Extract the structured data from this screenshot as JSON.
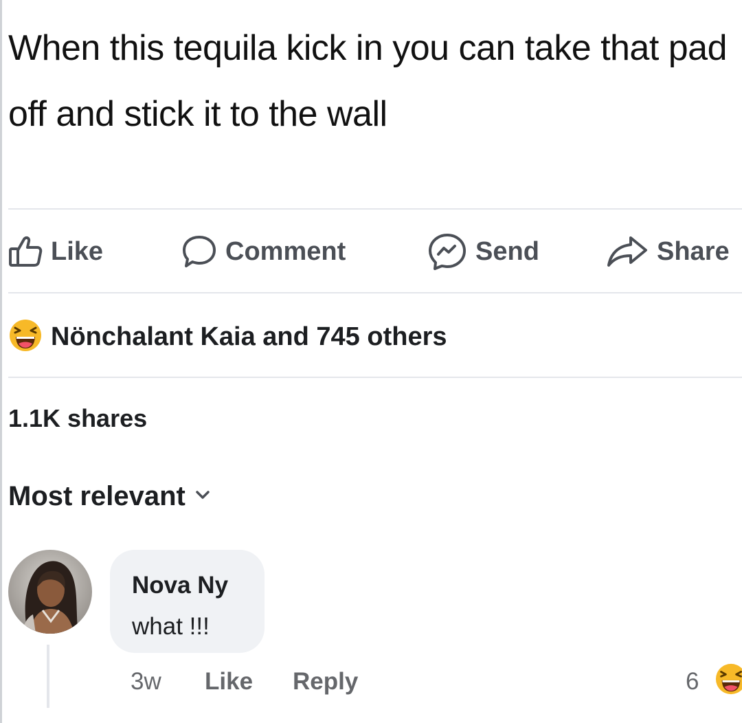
{
  "post": {
    "text": "When this tequila kick in you can take that pad off and stick it to the wall"
  },
  "actions": {
    "like": "Like",
    "comment": "Comment",
    "send": "Send",
    "share": "Share"
  },
  "reactions": {
    "icon": "laughing-emoji",
    "text": "Nönchalant Kaia and 745 others"
  },
  "shares": "1.1K shares",
  "sort": {
    "label": "Most relevant",
    "icon": "chevron-down-icon"
  },
  "comment": {
    "author": "Nova Ny",
    "text": "what !!!",
    "time": "3w",
    "like": "Like",
    "reply": "Reply",
    "reaction_count": "6",
    "reaction_icon": "laughing-emoji"
  },
  "colors": {
    "action_gray": "#4b4f56",
    "meta_gray": "#65676b",
    "bubble": "#f0f2f5",
    "divider": "#e4e6eb",
    "emoji_yellow": "#f7b928"
  }
}
